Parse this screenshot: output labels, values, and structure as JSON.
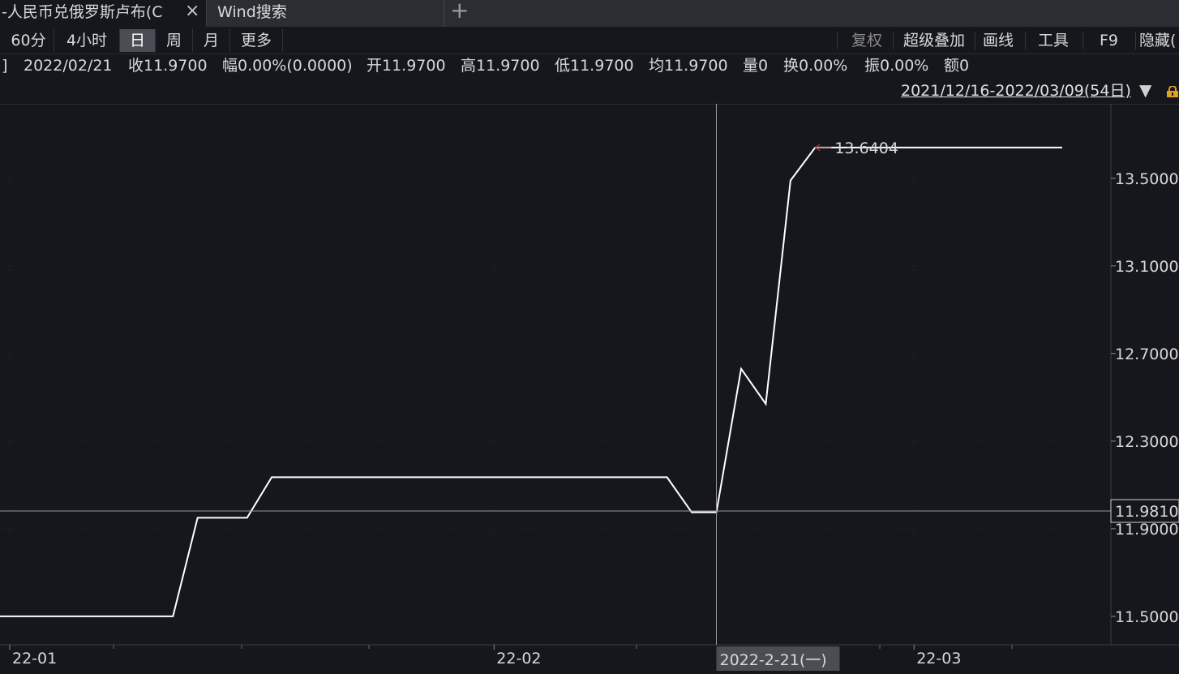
{
  "tabs": [
    {
      "label": "-人民币兑俄罗斯卢布(C",
      "close": "×"
    },
    {
      "label": "Wind搜索"
    }
  ],
  "tab_add": "+",
  "periods": [
    "60分",
    "4小时",
    "日",
    "周",
    "月",
    "更多"
  ],
  "selected_period": "日",
  "tools": [
    "复权",
    "超级叠加",
    "画线",
    "工具",
    "F9",
    "隐藏("
  ],
  "info": {
    "bracket": "]",
    "date": "2022/02/21",
    "close": "收11.9700",
    "change": "幅0.00%(0.0000)",
    "open": "开11.9700",
    "high": "高11.9700",
    "low": "低11.9700",
    "avg": "均11.9700",
    "volume": "量0",
    "turnover": "换0.00%",
    "amplitude": "振0.00%",
    "amount": "额0"
  },
  "range": {
    "text": "2021/12/16-2022/03/09(54日)",
    "arrow": "▼"
  },
  "colors": {
    "background": "#15171c",
    "line": "#ffffff",
    "max_label": "#e03030",
    "grid": "#2a2d33"
  },
  "chart_data": {
    "type": "line",
    "x_ticks": [
      "22-01",
      "22-02",
      "22-03"
    ],
    "y_ticks": [
      "13.5000",
      "13.1000",
      "12.7000",
      "12.3000",
      "11.9000",
      "11.5000"
    ],
    "ylim": [
      11.37,
      13.84
    ],
    "crosshair": {
      "x_label": "2022-2-21(一)",
      "y_label": "11.9810",
      "y_value": 11.981,
      "index": 29
    },
    "max_label": "13.6404",
    "series": [
      {
        "values": [
          11.5,
          11.5,
          11.5,
          11.5,
          11.5,
          11.5,
          11.5,
          11.5,
          11.95,
          11.95,
          11.95,
          12.135,
          12.135,
          12.135,
          12.135,
          12.135,
          12.135,
          12.135,
          12.135,
          12.135,
          12.135,
          12.135,
          12.135,
          12.135,
          12.135,
          12.135,
          12.135,
          12.135,
          11.975,
          11.975,
          12.63,
          12.47,
          13.49,
          13.6404,
          13.6404,
          13.6404,
          13.6404,
          13.6404,
          13.6404,
          13.6404,
          13.6404,
          13.6404,
          13.6404,
          13.6404
        ]
      }
    ]
  }
}
